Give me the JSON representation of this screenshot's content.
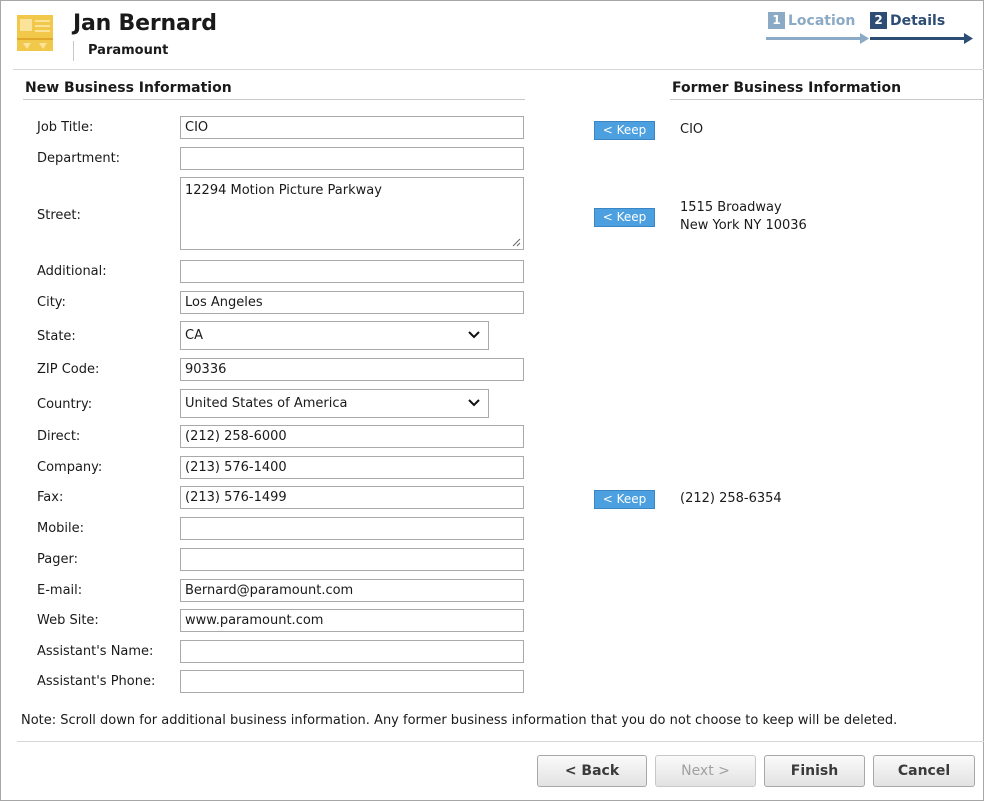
{
  "header": {
    "contact_name": "Jan Bernard",
    "company": "Paramount"
  },
  "wizard": {
    "steps": [
      {
        "num": "1",
        "label": "Location",
        "state": "completed"
      },
      {
        "num": "2",
        "label": "Details",
        "state": "active"
      }
    ]
  },
  "new_business": {
    "title": "New Business Information",
    "fields": {
      "job_title": {
        "label": "Job Title:",
        "value": "CIO"
      },
      "department": {
        "label": "Department:",
        "value": ""
      },
      "street": {
        "label": "Street:",
        "value": "12294 Motion Picture Parkway"
      },
      "additional": {
        "label": "Additional:",
        "value": ""
      },
      "city": {
        "label": "City:",
        "value": "Los Angeles"
      },
      "state": {
        "label": "State:",
        "value": "CA"
      },
      "zip": {
        "label": "ZIP Code:",
        "value": "90336"
      },
      "country": {
        "label": "Country:",
        "value": "United States of America"
      },
      "direct": {
        "label": "Direct:",
        "value": "(212) 258-6000"
      },
      "company": {
        "label": "Company:",
        "value": "(213) 576-1400"
      },
      "fax": {
        "label": "Fax:",
        "value": "(213) 576-1499"
      },
      "mobile": {
        "label": "Mobile:",
        "value": ""
      },
      "pager": {
        "label": "Pager:",
        "value": ""
      },
      "email": {
        "label": "E-mail:",
        "value": "Bernard@paramount.com"
      },
      "website": {
        "label": "Web Site:",
        "value": "www.paramount.com"
      },
      "assistant_name": {
        "label": "Assistant's Name:",
        "value": ""
      },
      "assistant_phone": {
        "label": "Assistant's Phone:",
        "value": ""
      }
    }
  },
  "former_business": {
    "title": "Former Business Information",
    "keep_label": "< Keep",
    "job_title": "CIO",
    "street_line1": "1515 Broadway",
    "street_line2": "New York NY 10036",
    "fax": "(212) 258-6354"
  },
  "note": "Note: Scroll down for additional business information. Any former business information that you do not choose to keep will be deleted.",
  "buttons": {
    "back": "< Back",
    "next": "Next >",
    "finish": "Finish",
    "cancel": "Cancel"
  },
  "colors": {
    "keep_button": "#4ca0e0",
    "wizard_active": "#2e4d74",
    "wizard_done": "#8aaac5",
    "contact_icon": "#f2c84b"
  },
  "icons": {
    "contact": "contact-card-icon",
    "select": "chevron-down-icon",
    "resize": "resize-grip-icon"
  }
}
